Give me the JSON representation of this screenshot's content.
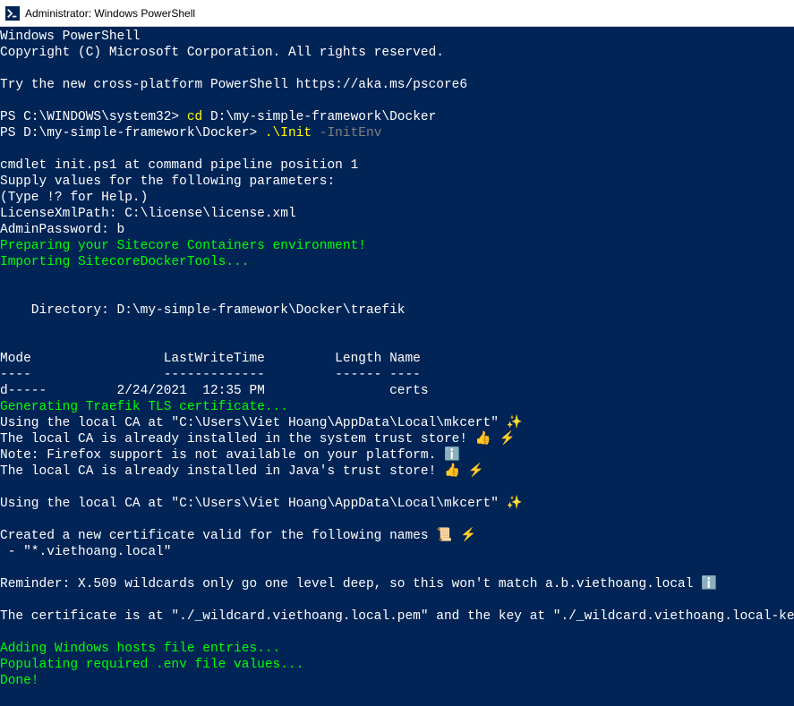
{
  "titlebar": {
    "title": "Administrator: Windows PowerShell"
  },
  "terminal": {
    "lines": [
      {
        "text": "Windows PowerShell",
        "class": ""
      },
      {
        "text": "Copyright (C) Microsoft Corporation. All rights reserved.",
        "class": ""
      },
      {
        "text": "",
        "class": ""
      },
      {
        "text": "Try the new cross-platform PowerShell https://aka.ms/pscore6",
        "class": ""
      },
      {
        "text": "",
        "class": ""
      }
    ],
    "prompt1": {
      "prefix": "PS C:\\WINDOWS\\system32> ",
      "cmd": "cd ",
      "arg": "D:\\my-simple-framework\\Docker"
    },
    "prompt2": {
      "prefix": "PS D:\\my-simple-framework\\Docker> ",
      "cmd": ".\\Init ",
      "param": "-InitEnv"
    },
    "lines2": [
      {
        "text": "",
        "class": ""
      },
      {
        "text": "cmdlet init.ps1 at command pipeline position 1",
        "class": ""
      },
      {
        "text": "Supply values for the following parameters:",
        "class": ""
      },
      {
        "text": "(Type !? for Help.)",
        "class": ""
      },
      {
        "text": "LicenseXmlPath: C:\\license\\license.xml",
        "class": ""
      },
      {
        "text": "AdminPassword: b",
        "class": ""
      },
      {
        "text": "Preparing your Sitecore Containers environment!",
        "class": "green"
      },
      {
        "text": "Importing SitecoreDockerTools...",
        "class": "green"
      },
      {
        "text": "",
        "class": ""
      },
      {
        "text": "",
        "class": ""
      },
      {
        "text": "    Directory: D:\\my-simple-framework\\Docker\\traefik",
        "class": ""
      },
      {
        "text": "",
        "class": ""
      },
      {
        "text": "",
        "class": ""
      },
      {
        "text": "Mode                 LastWriteTime         Length Name",
        "class": ""
      },
      {
        "text": "----                 -------------         ------ ----",
        "class": ""
      },
      {
        "text": "d-----         2/24/2021  12:35 PM                certs",
        "class": ""
      },
      {
        "text": "Generating Traefik TLS certificate...",
        "class": "green"
      },
      {
        "text": "Using the local CA at \"C:\\Users\\Viet Hoang\\AppData\\Local\\mkcert\" ✨",
        "class": ""
      },
      {
        "text": "The local CA is already installed in the system trust store! 👍 ⚡️",
        "class": ""
      },
      {
        "text": "Note: Firefox support is not available on your platform. ℹ️",
        "class": ""
      },
      {
        "text": "The local CA is already installed in Java's trust store! 👍 ⚡️",
        "class": ""
      },
      {
        "text": "",
        "class": ""
      },
      {
        "text": "Using the local CA at \"C:\\Users\\Viet Hoang\\AppData\\Local\\mkcert\" ✨",
        "class": ""
      },
      {
        "text": "",
        "class": ""
      },
      {
        "text": "Created a new certificate valid for the following names 📜 ⚡️",
        "class": ""
      },
      {
        "text": " - \"*.viethoang.local\"",
        "class": ""
      },
      {
        "text": "",
        "class": ""
      },
      {
        "text": "Reminder: X.509 wildcards only go one level deep, so this won't match a.b.viethoang.local ℹ️",
        "class": ""
      },
      {
        "text": "",
        "class": ""
      },
      {
        "text": "The certificate is at \"./_wildcard.viethoang.local.pem\" and the key at \"./_wildcard.viethoang.local-key.pem\" ✅",
        "class": ""
      },
      {
        "text": "",
        "class": ""
      },
      {
        "text": "Adding Windows hosts file entries...",
        "class": "green"
      },
      {
        "text": "Populating required .env file values...",
        "class": "green"
      },
      {
        "text": "Done!",
        "class": "green"
      }
    ]
  }
}
